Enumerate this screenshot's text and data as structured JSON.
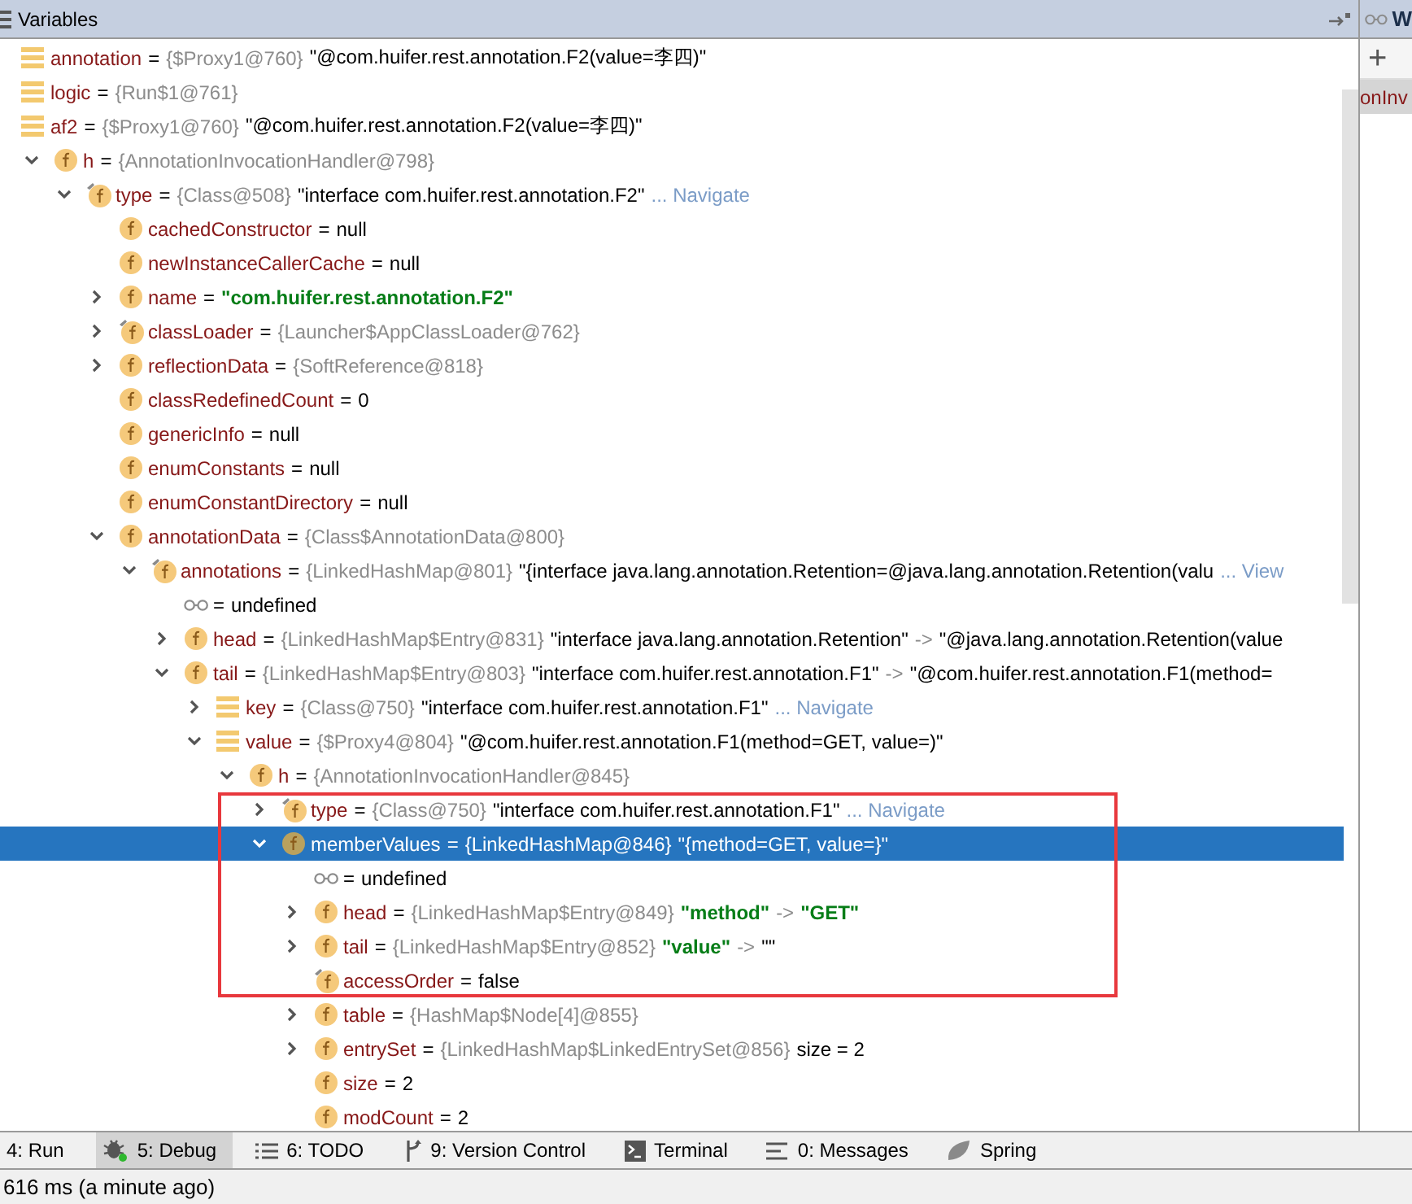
{
  "variables_panel": {
    "title": "Variables",
    "rows": [
      {
        "kind": "list",
        "name": "annotation",
        "parts": [
          {
            "kind": "eq",
            "t": "="
          },
          {
            "kind": "type",
            "t": "{$Proxy1@760}"
          },
          {
            "kind": "value",
            "t": "\"@com.huifer.rest.annotation.F2(value=李四)\""
          }
        ]
      },
      {
        "kind": "list",
        "name": "logic",
        "parts": [
          {
            "kind": "eq",
            "t": "="
          },
          {
            "kind": "type",
            "t": "{Run$1@761}"
          }
        ]
      },
      {
        "kind": "list",
        "name": "af2",
        "parts": [
          {
            "kind": "eq",
            "t": "="
          },
          {
            "kind": "type",
            "t": "{$Proxy1@760}"
          },
          {
            "kind": "value",
            "t": "\"@com.huifer.rest.annotation.F2(value=李四)\""
          }
        ],
        "children": [
          {
            "kind": "field",
            "name": "h",
            "expanded": true,
            "parts": [
              {
                "kind": "eq",
                "t": "="
              },
              {
                "kind": "type",
                "t": "{AnnotationInvocationHandler@798}"
              }
            ],
            "children": [
              {
                "kind": "final",
                "name": "type",
                "expanded": true,
                "parts": [
                  {
                    "kind": "eq",
                    "t": "="
                  },
                  {
                    "kind": "type",
                    "t": "{Class@508}"
                  },
                  {
                    "kind": "value",
                    "t": "\"interface com.huifer.rest.annotation.F2\""
                  },
                  {
                    "kind": "link",
                    "t": "... Navigate"
                  }
                ],
                "children": [
                  {
                    "kind": "field",
                    "name": "cachedConstructor",
                    "parts": [
                      {
                        "kind": "eq",
                        "t": "="
                      },
                      {
                        "kind": "value",
                        "t": "null"
                      }
                    ]
                  },
                  {
                    "kind": "field",
                    "name": "newInstanceCallerCache",
                    "parts": [
                      {
                        "kind": "eq",
                        "t": "="
                      },
                      {
                        "kind": "value",
                        "t": "null"
                      }
                    ]
                  },
                  {
                    "kind": "field",
                    "name": "name",
                    "expanded": false,
                    "parts": [
                      {
                        "kind": "eq",
                        "t": "="
                      },
                      {
                        "kind": "string",
                        "t": "\"com.huifer.rest.annotation.F2\""
                      }
                    ]
                  },
                  {
                    "kind": "final",
                    "name": "classLoader",
                    "expanded": false,
                    "parts": [
                      {
                        "kind": "eq",
                        "t": "="
                      },
                      {
                        "kind": "type",
                        "t": "{Launcher$AppClassLoader@762}"
                      }
                    ]
                  },
                  {
                    "kind": "field",
                    "name": "reflectionData",
                    "expanded": false,
                    "parts": [
                      {
                        "kind": "eq",
                        "t": "="
                      },
                      {
                        "kind": "type",
                        "t": "{SoftReference@818}"
                      }
                    ]
                  },
                  {
                    "kind": "field",
                    "name": "classRedefinedCount",
                    "parts": [
                      {
                        "kind": "eq",
                        "t": "="
                      },
                      {
                        "kind": "value",
                        "t": "0"
                      }
                    ]
                  },
                  {
                    "kind": "field",
                    "name": "genericInfo",
                    "parts": [
                      {
                        "kind": "eq",
                        "t": "="
                      },
                      {
                        "kind": "value",
                        "t": "null"
                      }
                    ]
                  },
                  {
                    "kind": "field",
                    "name": "enumConstants",
                    "parts": [
                      {
                        "kind": "eq",
                        "t": "="
                      },
                      {
                        "kind": "value",
                        "t": "null"
                      }
                    ]
                  },
                  {
                    "kind": "field",
                    "name": "enumConstantDirectory",
                    "parts": [
                      {
                        "kind": "eq",
                        "t": "="
                      },
                      {
                        "kind": "value",
                        "t": "null"
                      }
                    ]
                  },
                  {
                    "kind": "field",
                    "name": "annotationData",
                    "expanded": true,
                    "parts": [
                      {
                        "kind": "eq",
                        "t": "="
                      },
                      {
                        "kind": "type",
                        "t": "{Class$AnnotationData@800}"
                      }
                    ],
                    "children": [
                      {
                        "kind": "final",
                        "name": "annotations",
                        "expanded": true,
                        "parts": [
                          {
                            "kind": "eq",
                            "t": "="
                          },
                          {
                            "kind": "type",
                            "t": "{LinkedHashMap@801}"
                          },
                          {
                            "kind": "value",
                            "t": "\"{interface java.lang.annotation.Retention=@java.lang.annotation.Retention(valu"
                          },
                          {
                            "kind": "link",
                            "t": "... View"
                          }
                        ],
                        "children": [
                          {
                            "kind": "watch",
                            "parts": [
                              {
                                "kind": "eq",
                                "t": "="
                              },
                              {
                                "kind": "value",
                                "t": "undefined"
                              }
                            ]
                          },
                          {
                            "kind": "field",
                            "name": "head",
                            "expanded": false,
                            "parts": [
                              {
                                "kind": "eq",
                                "t": "="
                              },
                              {
                                "kind": "type",
                                "t": "{LinkedHashMap$Entry@831}"
                              },
                              {
                                "kind": "value",
                                "t": "\"interface java.lang.annotation.Retention\""
                              },
                              {
                                "kind": "arrow",
                                "t": "->"
                              },
                              {
                                "kind": "value",
                                "t": "\"@java.lang.annotation.Retention(value"
                              }
                            ]
                          },
                          {
                            "kind": "field",
                            "name": "tail",
                            "expanded": true,
                            "parts": [
                              {
                                "kind": "eq",
                                "t": "="
                              },
                              {
                                "kind": "type",
                                "t": "{LinkedHashMap$Entry@803}"
                              },
                              {
                                "kind": "value",
                                "t": "\"interface com.huifer.rest.annotation.F1\""
                              },
                              {
                                "kind": "arrow",
                                "t": "->"
                              },
                              {
                                "kind": "value",
                                "t": "\"@com.huifer.rest.annotation.F1(method="
                              }
                            ],
                            "children": [
                              {
                                "kind": "list",
                                "name": "key",
                                "expanded": false,
                                "parts": [
                                  {
                                    "kind": "eq",
                                    "t": "="
                                  },
                                  {
                                    "kind": "type",
                                    "t": "{Class@750}"
                                  },
                                  {
                                    "kind": "value",
                                    "t": "\"interface com.huifer.rest.annotation.F1\""
                                  },
                                  {
                                    "kind": "link",
                                    "t": "... Navigate"
                                  }
                                ]
                              },
                              {
                                "kind": "list",
                                "name": "value",
                                "expanded": true,
                                "parts": [
                                  {
                                    "kind": "eq",
                                    "t": "="
                                  },
                                  {
                                    "kind": "type",
                                    "t": "{$Proxy4@804}"
                                  },
                                  {
                                    "kind": "value",
                                    "t": "\"@com.huifer.rest.annotation.F1(method=GET, value=)\""
                                  }
                                ],
                                "children": [
                                  {
                                    "kind": "field",
                                    "name": "h",
                                    "expanded": true,
                                    "parts": [
                                      {
                                        "kind": "eq",
                                        "t": "="
                                      },
                                      {
                                        "kind": "type",
                                        "t": "{AnnotationInvocationHandler@845}"
                                      }
                                    ],
                                    "children": [
                                      {
                                        "kind": "final",
                                        "name": "type",
                                        "expanded": false,
                                        "boxed": true,
                                        "parts": [
                                          {
                                            "kind": "eq",
                                            "t": "="
                                          },
                                          {
                                            "kind": "type",
                                            "t": "{Class@750}"
                                          },
                                          {
                                            "kind": "value",
                                            "t": "\"interface com.huifer.rest.annotation.F1\""
                                          },
                                          {
                                            "kind": "link",
                                            "t": "... Navigate"
                                          }
                                        ]
                                      },
                                      {
                                        "kind": "field",
                                        "name": "memberValues",
                                        "expanded": true,
                                        "selected": true,
                                        "boxed": true,
                                        "parts": [
                                          {
                                            "kind": "eq",
                                            "t": "="
                                          },
                                          {
                                            "kind": "type",
                                            "t": "{LinkedHashMap@846}"
                                          },
                                          {
                                            "kind": "value",
                                            "t": "\"{method=GET, value=}\""
                                          }
                                        ],
                                        "children": [
                                          {
                                            "kind": "watch",
                                            "boxed": true,
                                            "parts": [
                                              {
                                                "kind": "eq",
                                                "t": "="
                                              },
                                              {
                                                "kind": "value",
                                                "t": "undefined"
                                              }
                                            ]
                                          },
                                          {
                                            "kind": "field",
                                            "name": "head",
                                            "expanded": false,
                                            "boxed": true,
                                            "parts": [
                                              {
                                                "kind": "eq",
                                                "t": "="
                                              },
                                              {
                                                "kind": "type",
                                                "t": "{LinkedHashMap$Entry@849}"
                                              },
                                              {
                                                "kind": "string",
                                                "t": "\"method\""
                                              },
                                              {
                                                "kind": "arrow",
                                                "t": "->"
                                              },
                                              {
                                                "kind": "string",
                                                "t": "\"GET\""
                                              }
                                            ]
                                          },
                                          {
                                            "kind": "field",
                                            "name": "tail",
                                            "expanded": false,
                                            "boxed": true,
                                            "parts": [
                                              {
                                                "kind": "eq",
                                                "t": "="
                                              },
                                              {
                                                "kind": "type",
                                                "t": "{LinkedHashMap$Entry@852}"
                                              },
                                              {
                                                "kind": "string",
                                                "t": "\"value\""
                                              },
                                              {
                                                "kind": "arrow",
                                                "t": "->"
                                              },
                                              {
                                                "kind": "value",
                                                "t": "\"\""
                                              }
                                            ]
                                          },
                                          {
                                            "kind": "final",
                                            "name": "accessOrder",
                                            "boxed": true,
                                            "parts": [
                                              {
                                                "kind": "eq",
                                                "t": "="
                                              },
                                              {
                                                "kind": "value",
                                                "t": "false"
                                              }
                                            ]
                                          },
                                          {
                                            "kind": "field",
                                            "name": "table",
                                            "expanded": false,
                                            "parts": [
                                              {
                                                "kind": "eq",
                                                "t": "="
                                              },
                                              {
                                                "kind": "type",
                                                "t": "{HashMap$Node[4]@855}"
                                              }
                                            ]
                                          },
                                          {
                                            "kind": "field",
                                            "name": "entrySet",
                                            "expanded": false,
                                            "parts": [
                                              {
                                                "kind": "eq",
                                                "t": "="
                                              },
                                              {
                                                "kind": "type",
                                                "t": "{LinkedHashMap$LinkedEntrySet@856}"
                                              },
                                              {
                                                "kind": "value",
                                                "t": "size = 2"
                                              }
                                            ]
                                          },
                                          {
                                            "kind": "field",
                                            "name": "size",
                                            "parts": [
                                              {
                                                "kind": "eq",
                                                "t": "="
                                              },
                                              {
                                                "kind": "value",
                                                "t": "2"
                                              }
                                            ]
                                          },
                                          {
                                            "kind": "field",
                                            "name": "modCount",
                                            "parts": [
                                              {
                                                "kind": "eq",
                                                "t": "="
                                              },
                                              {
                                                "kind": "value",
                                                "t": "2"
                                              }
                                            ]
                                          }
                                        ]
                                      }
                                    ]
                                  }
                                ]
                              }
                            ]
                          }
                        ]
                      }
                    ]
                  }
                ]
              }
            ]
          }
        ]
      }
    ]
  },
  "watches_panel": {
    "title": "W",
    "add_button": "+",
    "items": [
      {
        "label": "onInv",
        "selected": true
      }
    ]
  },
  "tool_tabs": [
    {
      "kind": "run",
      "label": "4: Run",
      "selected": false
    },
    {
      "kind": "debug",
      "label": "5: Debug",
      "selected": true
    },
    {
      "kind": "todo",
      "label": "6: TODO",
      "selected": false
    },
    {
      "kind": "vcs",
      "label": "9: Version Control",
      "selected": false
    },
    {
      "kind": "terminal",
      "label": "Terminal",
      "selected": false
    },
    {
      "kind": "messages",
      "label": "0: Messages",
      "selected": false
    },
    {
      "kind": "spring",
      "label": "Spring",
      "selected": false
    }
  ],
  "status_bar": "616 ms (a minute ago)"
}
